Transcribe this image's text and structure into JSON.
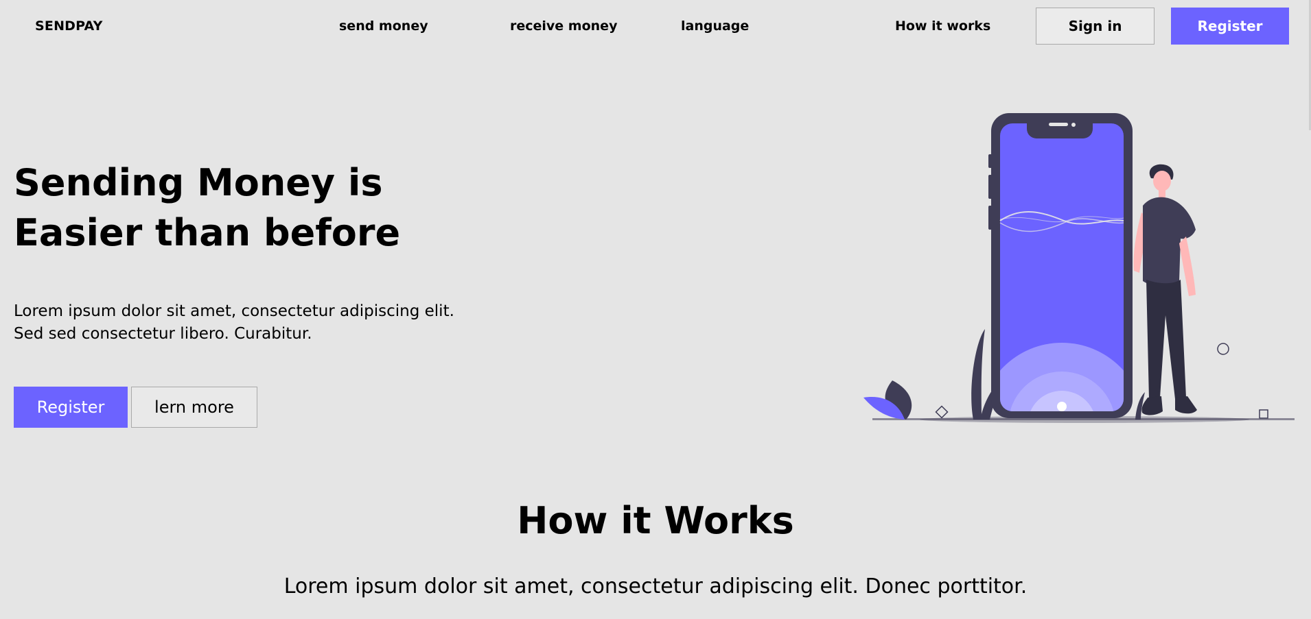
{
  "nav": {
    "brand": "SENDPAY",
    "links": [
      "send money",
      "receive money",
      "language",
      "How it works"
    ],
    "signin": "Sign in",
    "register": "Register"
  },
  "hero": {
    "title_lines": [
      "Sending Money is",
      "Easier than before"
    ],
    "text_lines": [
      "Lorem ipsum dolor sit amet, consectetur adipiscing elit.",
      "Sed sed consectetur libero. Curabitur."
    ],
    "register": "Register",
    "learn_more": "lern more"
  },
  "how": {
    "title": "How it Works",
    "text": "Lorem ipsum dolor sit amet, consectetur adipiscing elit. Donec porttitor."
  },
  "colors": {
    "accent": "#6c63ff",
    "background": "#e5e5e5",
    "dark": "#3f3d56"
  },
  "icons": {
    "illustration": "person-with-phone-illustration"
  }
}
